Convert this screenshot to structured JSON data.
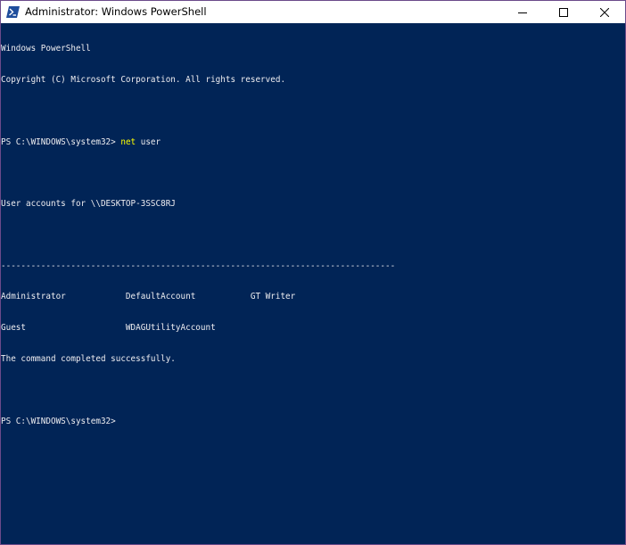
{
  "window": {
    "title": "Administrator: Windows PowerShell",
    "icon": "powershell-icon",
    "controls": {
      "minimize_icon": "minimize-icon",
      "maximize_icon": "maximize-icon",
      "close_icon": "close-icon"
    }
  },
  "console": {
    "background_color": "#012456",
    "text_color": "#eeedf0",
    "command_color": "#ffff00",
    "lines": {
      "banner": "Windows PowerShell",
      "copyright": "Copyright (C) Microsoft Corporation. All rights reserved.",
      "prompt1": "PS C:\\WINDOWS\\system32> ",
      "command_name": "net",
      "command_args": " user",
      "accounts_header": "User accounts for \\\\DESKTOP-3SSC8RJ",
      "separator": "-------------------------------------------------------------------------------",
      "row1": "Administrator            DefaultAccount           GT Writer",
      "row2": "Guest                    WDAGUtilityAccount",
      "completion": "The command completed successfully.",
      "prompt2": "PS C:\\WINDOWS\\system32>"
    }
  }
}
